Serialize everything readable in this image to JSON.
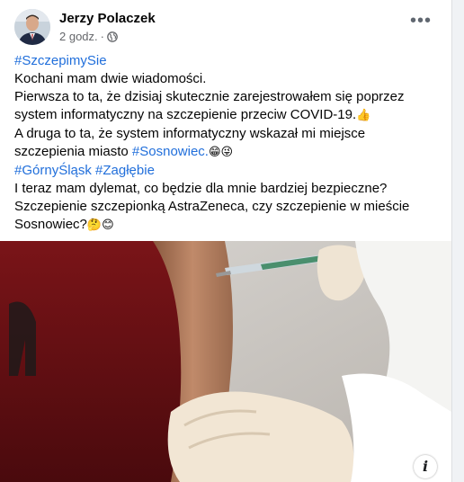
{
  "post": {
    "author": "Jerzy Polaczek",
    "time": "2 godz.",
    "separator": "·",
    "more_label": "•••",
    "privacy_icon": "globe-icon",
    "lines": [
      {
        "type": "hashtag",
        "text": "#SzczepimySie"
      },
      {
        "type": "plain",
        "text": "Kochani mam dwie wiadomości."
      },
      {
        "type": "plain",
        "text": "Pierwsza to ta, że dzisiaj skutecznie zarejestrowałem się poprzez"
      },
      {
        "type": "plain_emoji",
        "text": "system informatyczny na szczepienie przeciw COVID-19.",
        "emoji": "👍"
      },
      {
        "type": "plain",
        "text": " A druga to ta, że system informatyczny wskazał mi miejsce"
      },
      {
        "type": "mixed",
        "text": "szczepienia miasto ",
        "hashtag": "#Sosnowiec.",
        "emoji": "😁😜"
      },
      {
        "type": "hashtag",
        "text": "#GórnyŚląsk #Zagłębie"
      },
      {
        "type": "plain",
        "text": "I teraz mam dylemat, co będzie dla mnie bardziej bezpieczne?"
      },
      {
        "type": "plain",
        "text": "Szczepienie szczepionką AstraZeneca, czy szczepienie w mieście"
      },
      {
        "type": "plain_emoji",
        "text": "Sosnowiec?",
        "emoji": "🤔😊"
      }
    ],
    "info_label": "i"
  }
}
